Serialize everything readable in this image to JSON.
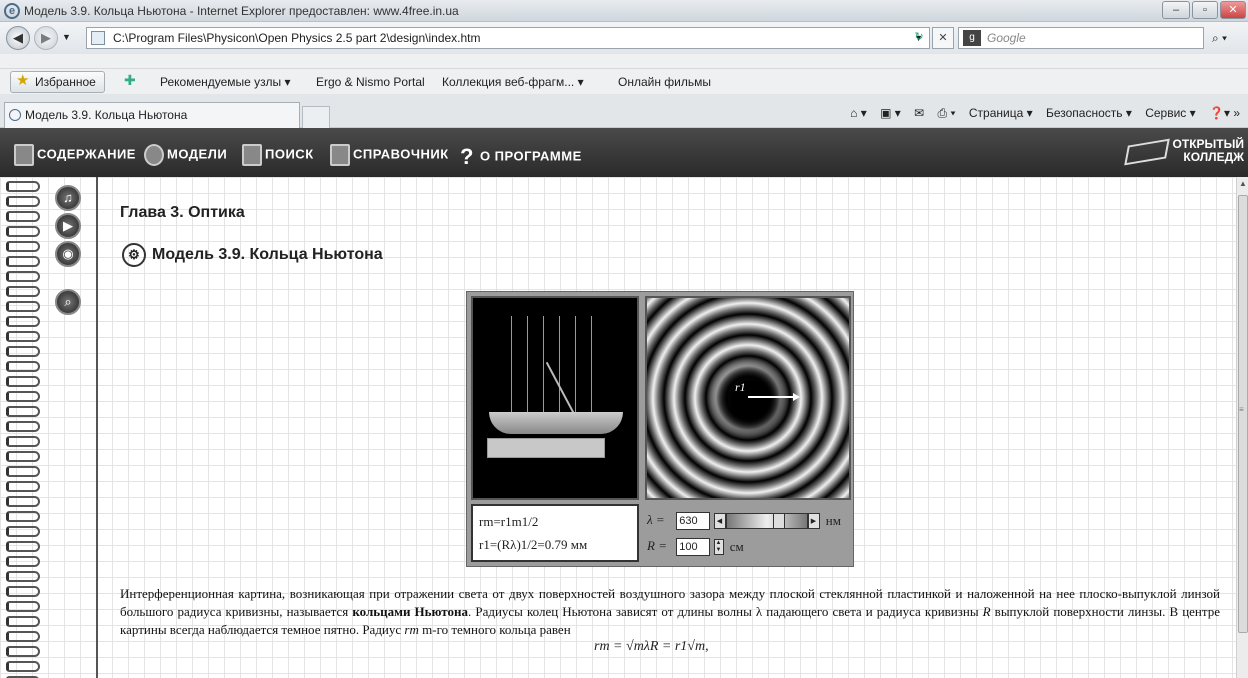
{
  "window": {
    "title": "Модель 3.9. Кольца Ньютона - Internet Explorer предоставлен: www.4free.in.ua"
  },
  "address": {
    "url": "C:\\Program Files\\Physicon\\Open Physics 2.5 part 2\\design\\index.htm",
    "search_placeholder": "Google"
  },
  "favorites": {
    "label": "Избранное",
    "links": [
      "Рекомендуемые узлы ▾",
      "Ergo & Nismo Portal",
      "Коллекция веб-фрагм... ▾",
      "Онлайн фильмы"
    ]
  },
  "tab": {
    "label": "Модель 3.9. Кольца Ньютона"
  },
  "command_bar": {
    "page": "Страница ▾",
    "security": "Безопасность ▾",
    "tools": "Сервис ▾"
  },
  "app_nav": {
    "items": [
      "СОДЕРЖАНИЕ",
      "МОДЕЛИ",
      "ПОИСК",
      "СПРАВОЧНИК",
      "О ПРОГРАММЕ"
    ],
    "help_glyph": "?",
    "brand_line1": "ОТКРЫТЫЙ",
    "brand_line2": "КОЛЛЕДЖ"
  },
  "content": {
    "chapter": "Глава 3. Оптика",
    "model_title": "Модель 3.9.  Кольца Ньютона"
  },
  "applet": {
    "ring_label": "r1",
    "formula_line1": "rm=r1m1/2",
    "formula_line2": "r1=(Rλ)1/2=0.79 мм",
    "lambda_label": "λ =",
    "lambda_value": "630",
    "lambda_unit": "нм",
    "R_label": "R =",
    "R_value": "100",
    "R_unit": "см"
  },
  "paragraph": {
    "part1": "Интерференционная картина, возникающая при отражении света от двух поверхностей воздушного зазора между плоской стеклянной пластинкой и наложенной на нее плоско-выпуклой линзой большого радиуса кривизны, называется ",
    "bold": "кольцами Ньютона",
    "part2": ". Радиусы колец Ньютона зависят от длины волны λ падающего света и радиуса кривизны ",
    "R": "R",
    "part3": " выпуклой поверхности линзы. В центре картины всегда наблюдается темное пятно. Радиус ",
    "rm": "rm",
    "part4": " m-го темного кольца равен"
  },
  "equation": "rm = √mλR = r1√m,",
  "colors": {
    "nav_bg": "#333333",
    "page_bg": "#ffffff",
    "grid": "#e4e4e4"
  }
}
